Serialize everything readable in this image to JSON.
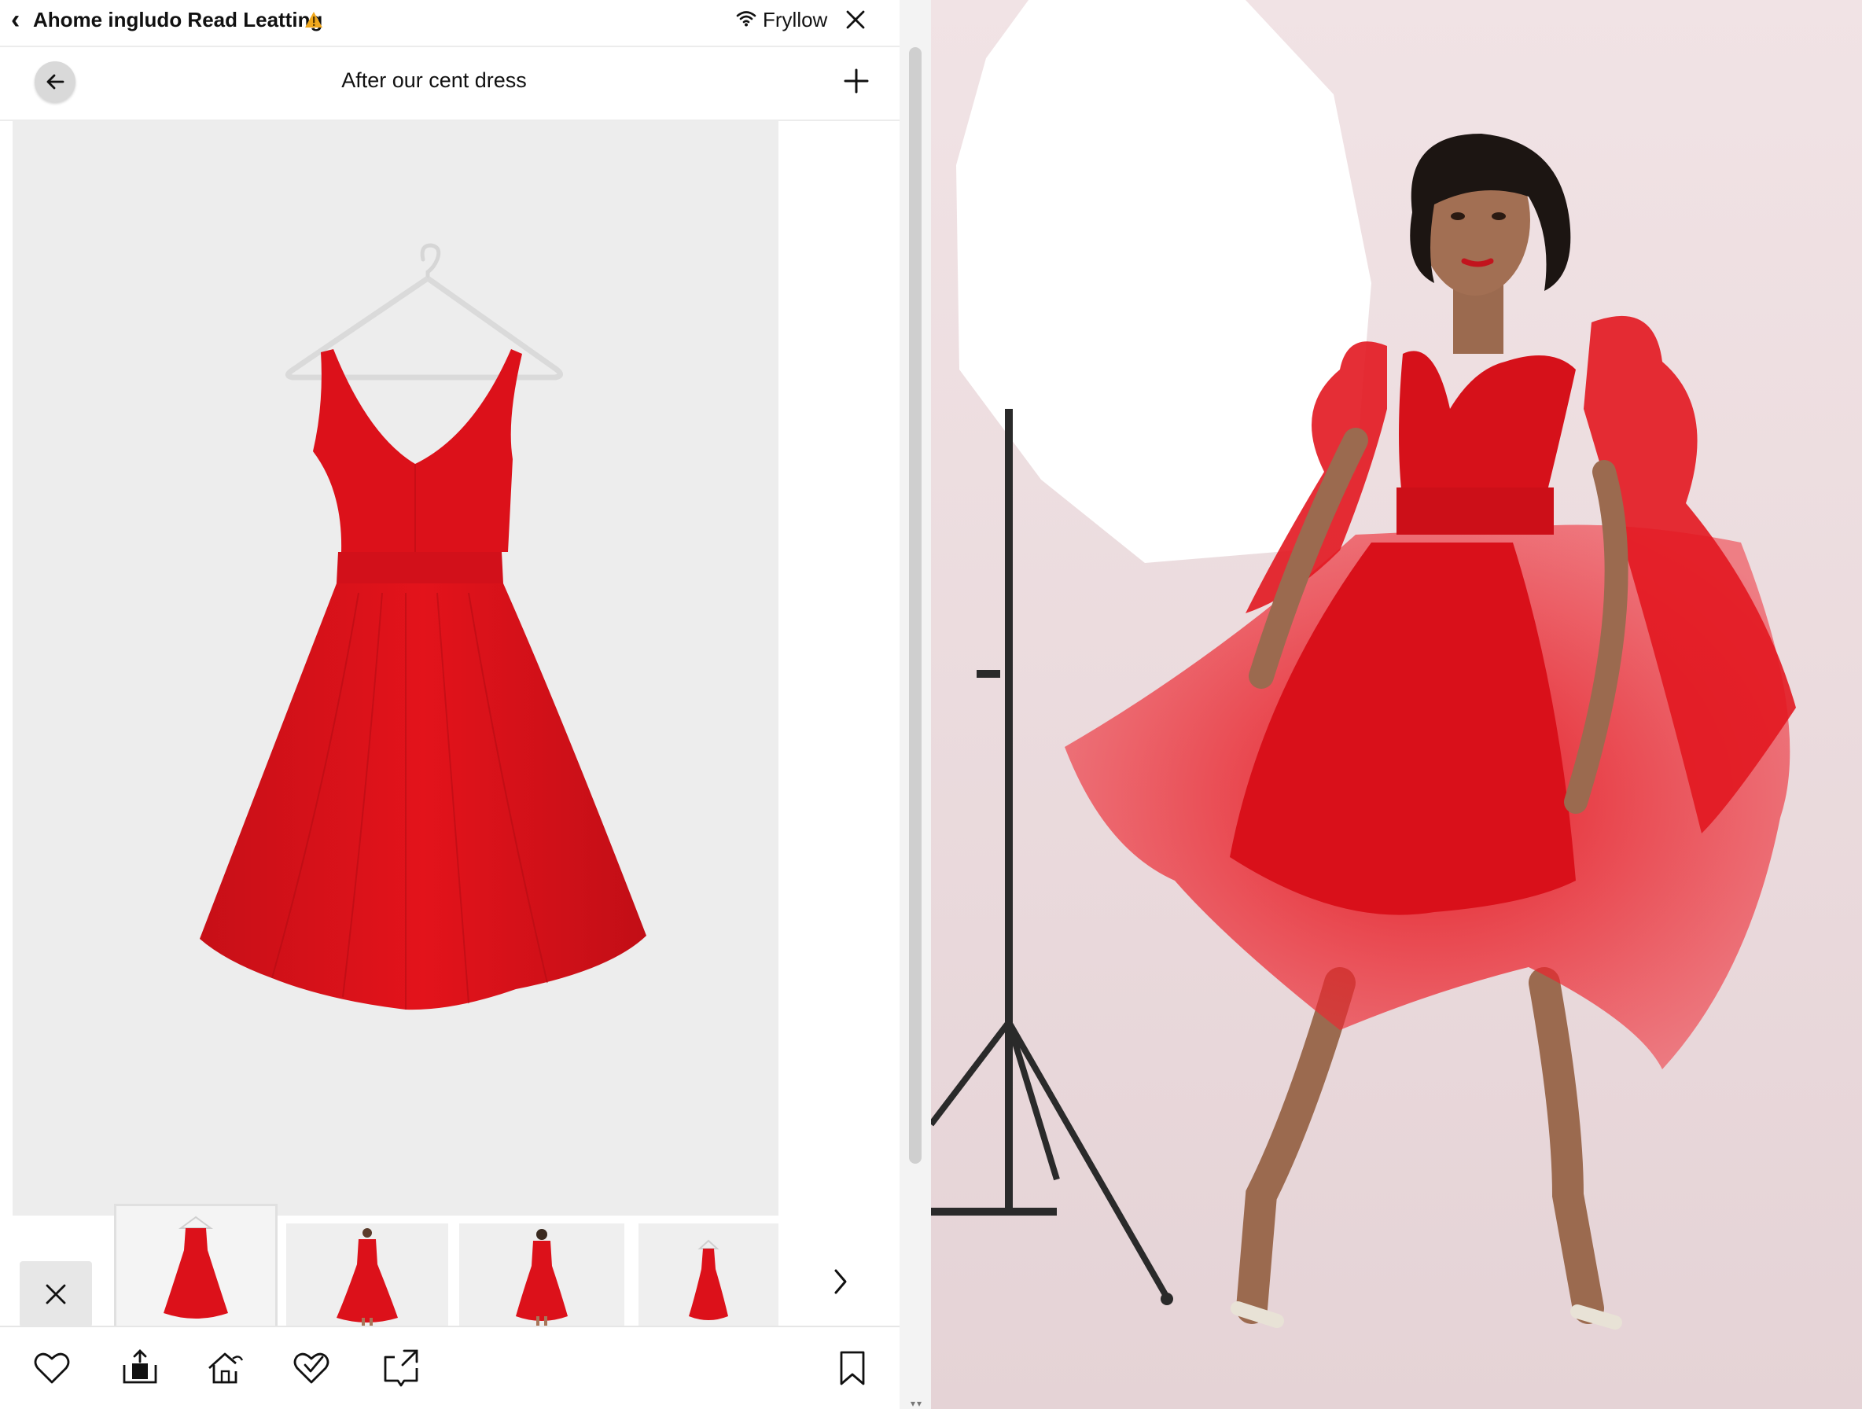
{
  "statusbar": {
    "title": "Ahome ingludo Read Leatting",
    "back_icon": "chevron-left-icon",
    "warning_icon": "warning-icon",
    "network_label": "Fryllow",
    "wifi_icon": "wifi-icon",
    "close_icon": "close-icon"
  },
  "header": {
    "title": "After our cent dress",
    "back_icon": "arrow-left-icon",
    "add_icon": "plus-icon"
  },
  "product": {
    "image": "red-dress-on-hanger",
    "color": "#e3131b"
  },
  "thumbnails": {
    "items": [
      {
        "image": "dress-on-hanger",
        "selected": true
      },
      {
        "image": "dress-front"
      },
      {
        "image": "dress-back"
      },
      {
        "image": "dress-small-hanger"
      }
    ],
    "close_icon": "close-icon",
    "next_icon": "chevron-right-icon"
  },
  "actions": [
    {
      "icon": "heart-icon"
    },
    {
      "icon": "upload-icon"
    },
    {
      "icon": "home-share-icon"
    },
    {
      "icon": "heart-check-icon"
    },
    {
      "icon": "share-box-icon"
    },
    {
      "icon": "bookmark-icon"
    }
  ],
  "preview": {
    "image": "model-in-red-dress-studio",
    "background": "#ecd9dc"
  }
}
